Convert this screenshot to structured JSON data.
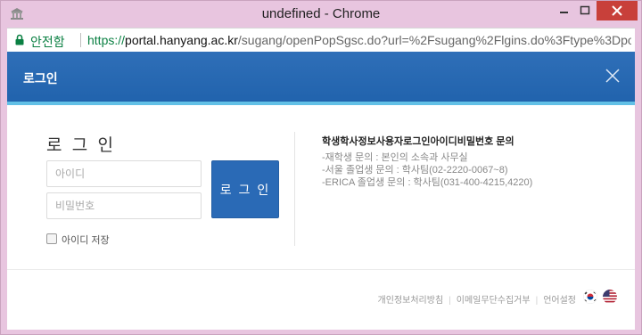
{
  "window": {
    "title": "undefined - Chrome",
    "icon": "app-icon",
    "controls": [
      "minimize-icon",
      "maximize-icon",
      "close-icon"
    ]
  },
  "addressbar": {
    "secure_label": "안전함",
    "url_scheme": "https://",
    "url_host": "portal.hanyang.ac.kr",
    "url_path": "/sugang/openPopSgsc.do?url=%2Fsugang%2Flgins.do%3Ftype%3Dpop%"
  },
  "header": {
    "title": "로그인",
    "close_icon": "close-icon"
  },
  "login": {
    "heading": "로 그 인",
    "id_placeholder": "아이디",
    "pw_placeholder": "비밀번호",
    "button_label": "로 그 인",
    "save_id_label": "아이디 저장"
  },
  "info": {
    "title": "학생학사정보사용자로그인아이디비밀번호 문의",
    "lines": [
      "-재학생 문의 : 본인의 소속과 사무실",
      "-서울 졸업생 문의 : 학사팀(02-2220-0067~8)",
      "-ERICA 졸업생 문의 : 학사팀(031-400-4215,4220)"
    ]
  },
  "footer": {
    "links": [
      "개인정보처리방침",
      "이메일무단수집거부",
      "언어설정"
    ],
    "flags": [
      "korea-flag-icon",
      "usa-flag-icon"
    ]
  },
  "colors": {
    "header_blue": "#2163ad",
    "header_stripe": "#62c0e6",
    "button_blue": "#2a6ab6",
    "secure_green": "#0b8043",
    "window_frame": "#e8c5df",
    "close_red": "#c8403a"
  }
}
